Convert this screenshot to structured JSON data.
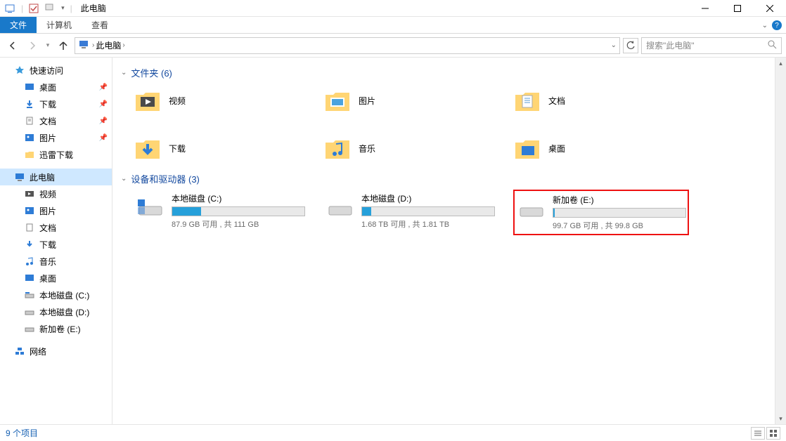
{
  "titlebar": {
    "title": "此电脑"
  },
  "ribbon": {
    "file": "文件",
    "computer": "计算机",
    "view": "查看"
  },
  "addressbar": {
    "crumb": "此电脑"
  },
  "search": {
    "placeholder": "搜索\"此电脑\""
  },
  "sidebar": {
    "quick_access": "快速访问",
    "desktop": "桌面",
    "downloads": "下载",
    "documents": "文档",
    "pictures": "图片",
    "xunlei": "迅雷下载",
    "this_pc": "此电脑",
    "videos": "视频",
    "pictures2": "图片",
    "documents2": "文档",
    "downloads2": "下载",
    "music": "音乐",
    "desktop2": "桌面",
    "drive_c": "本地磁盘 (C:)",
    "drive_d": "本地磁盘 (D:)",
    "drive_e": "新加卷 (E:)",
    "network": "网络"
  },
  "groups": {
    "folders_header": "文件夹 (6)",
    "devices_header": "设备和驱动器 (3)"
  },
  "folders": {
    "videos": "视频",
    "pictures": "图片",
    "documents": "文档",
    "downloads": "下载",
    "music": "音乐",
    "desktop": "桌面"
  },
  "drives": [
    {
      "name": "本地磁盘 (C:)",
      "status": "87.9 GB 可用 , 共 111 GB",
      "fill_pct": 22
    },
    {
      "name": "本地磁盘 (D:)",
      "status": "1.68 TB 可用 , 共 1.81 TB",
      "fill_pct": 7
    },
    {
      "name": "新加卷 (E:)",
      "status": "99.7 GB 可用 , 共 99.8 GB",
      "fill_pct": 1
    }
  ],
  "statusbar": {
    "items": "9 个项目"
  }
}
